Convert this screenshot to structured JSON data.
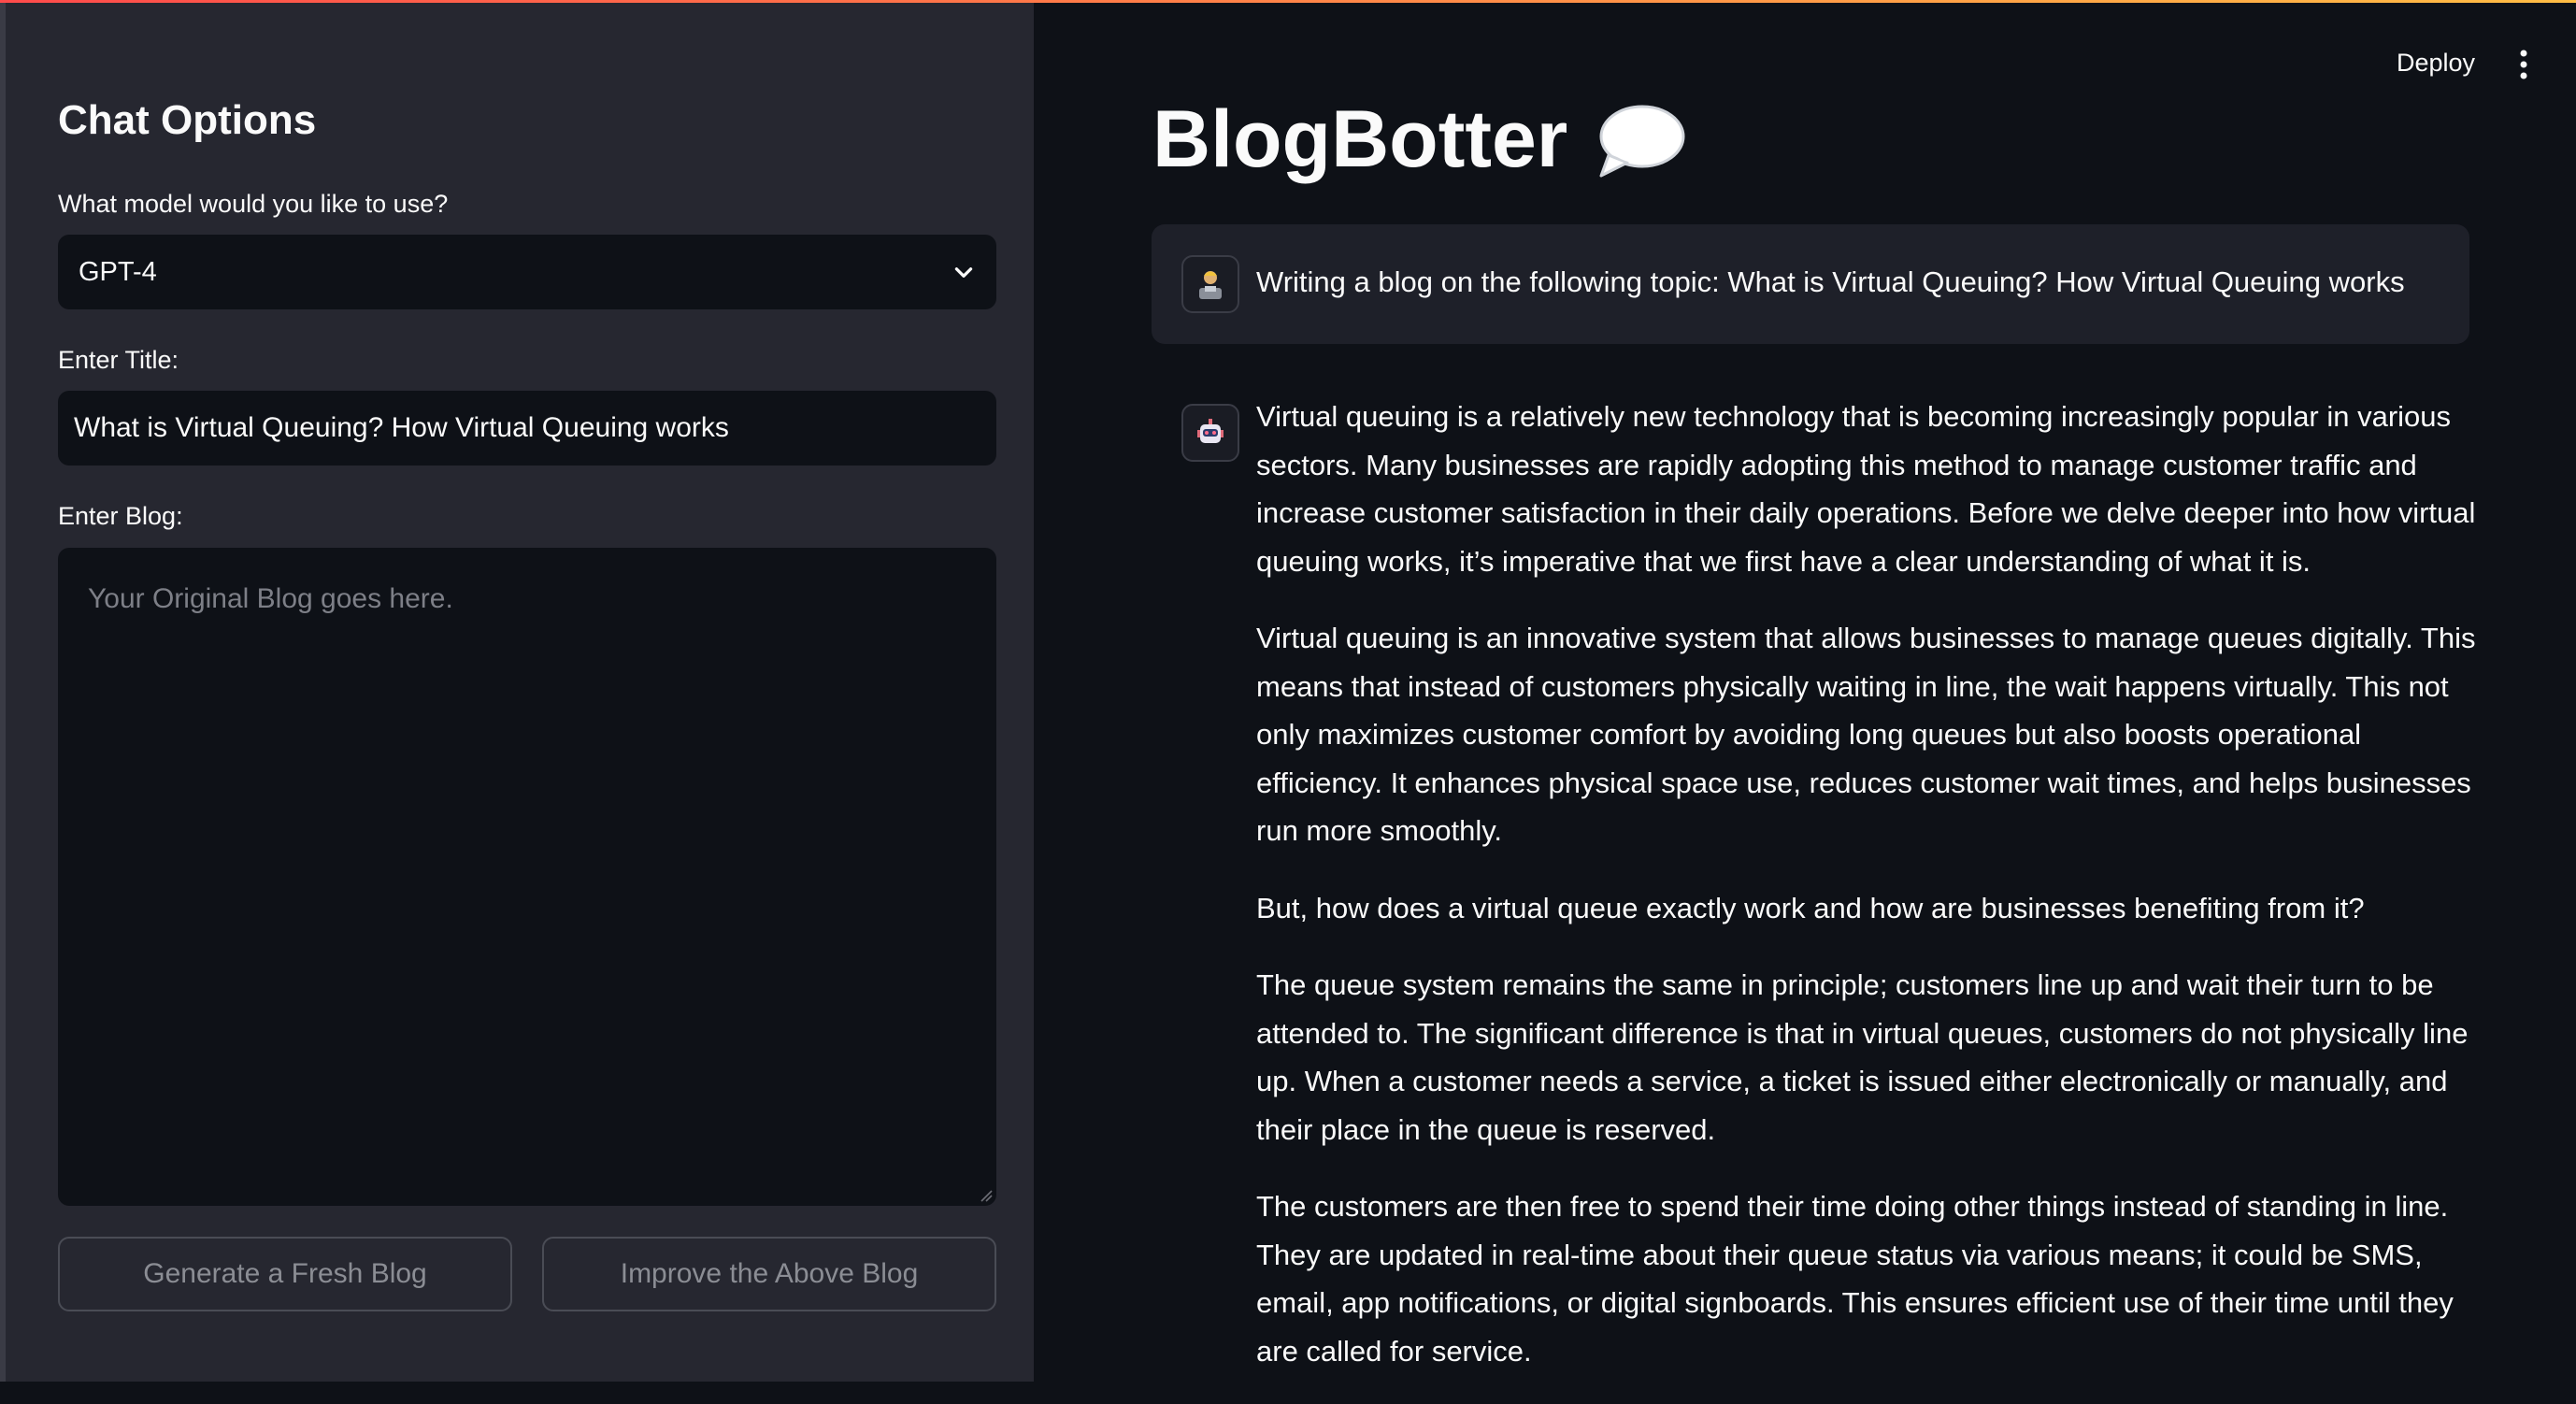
{
  "sidebar": {
    "title": "Chat Options",
    "model_label": "What model would you like to use?",
    "model_value": "GPT-4",
    "title_label": "Enter Title:",
    "title_value": "What is Virtual Queuing? How Virtual Queuing works",
    "blog_label": "Enter Blog:",
    "blog_placeholder": "Your Original Blog goes here.",
    "generate_button": "Generate a Fresh Blog",
    "improve_button": "Improve the Above Blog"
  },
  "toolbar": {
    "deploy_label": "Deploy",
    "menu_icon": "kebab-menu-icon"
  },
  "main": {
    "app_title": "BlogBotter",
    "title_icon": "speech-bubble-icon",
    "user_message": "Writing a blog on the following topic: What is Virtual Queuing? How Virtual Queuing works",
    "user_avatar": "user-avatar-icon",
    "assistant_avatar": "robot-avatar-icon",
    "assistant_paragraphs": [
      "Virtual queuing is a relatively new technology that is becoming increasingly popular in various sectors. Many businesses are rapidly adopting this method to manage customer traffic and increase customer satisfaction in their daily operations. Before we delve deeper into how virtual queuing works, it’s imperative that we first have a clear understanding of what it is.",
      "Virtual queuing is an innovative system that allows businesses to manage queues digitally. This means that instead of customers physically waiting in line, the wait happens virtually. This not only maximizes customer comfort by avoiding long queues but also boosts operational efficiency. It enhances physical space use, reduces customer wait times, and helps businesses run more smoothly.",
      "But, how does a virtual queue exactly work and how are businesses benefiting from it?",
      "The queue system remains the same in principle; customers line up and wait their turn to be attended to. The significant difference is that in virtual queues, customers do not physically line up. When a customer needs a service, a ticket is issued either electronically or manually, and their place in the queue is reserved.",
      "The customers are then free to spend their time doing other things instead of standing in line. They are updated in real-time about their queue status via various means; it could be SMS, email, app notifications, or digital signboards. This ensures efficient use of their time until they are called for service."
    ]
  },
  "colors": {
    "sidebar_bg": "#262730",
    "main_bg": "#0e1117",
    "input_bg": "#0e1117",
    "text": "#fafafa",
    "muted": "#8b8d94",
    "user_msg_bg": "#1e2029"
  }
}
